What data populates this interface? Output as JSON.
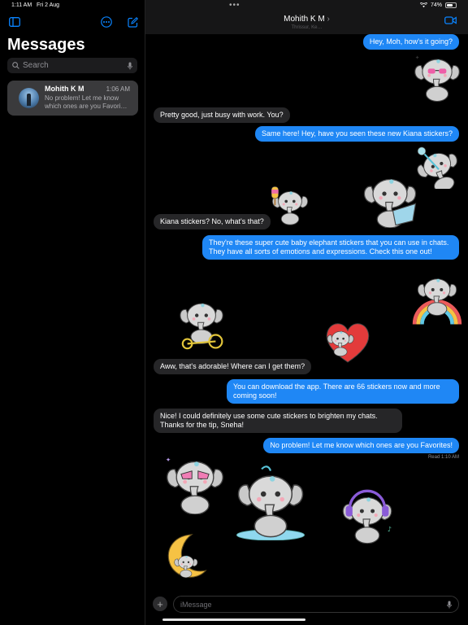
{
  "status_bar": {
    "time": "1:11 AM",
    "date": "Fri 2 Aug",
    "battery": "74%",
    "battery_level": 0.74
  },
  "sidebar": {
    "title": "Messages",
    "search_placeholder": "Search",
    "conversations": [
      {
        "name": "Mohith K M",
        "time": "1:06 AM",
        "preview": "No problem! Let me know which ones are you Favori…"
      }
    ]
  },
  "chat": {
    "contact_name": "Mohith K M",
    "contact_subtitle": "Thrissur, Ke…",
    "messages": [
      {
        "dir": "out",
        "text": "Hey, Moh, how's it going?"
      },
      {
        "dir": "in",
        "text": "Pretty good, just busy with work. You?"
      },
      {
        "dir": "out",
        "text": "Same here! Hey, have you seen these new Kiana stickers?"
      },
      {
        "dir": "in",
        "text": "Kiana stickers? No, what's that?"
      },
      {
        "dir": "out",
        "text": "They're these super cute baby elephant stickers that you can use in chats. They have all sorts of emotions and expressions. Check this one out!"
      },
      {
        "dir": "in",
        "text": "Aww, that's adorable! Where can I get them?"
      },
      {
        "dir": "out",
        "text": "You can download the app. There are 66 stickers now and more coming soon!"
      },
      {
        "dir": "in",
        "text": "Nice! I could definitely use some cute stickers to brighten my chats. Thanks for the tip, Sneha!"
      },
      {
        "dir": "out",
        "text": "No problem! Let me know which ones are you Favorites!"
      }
    ],
    "read_receipt": "Read 1:10 AM",
    "stickers": [
      {
        "name": "sticker-elephant-sunglasses"
      },
      {
        "name": "sticker-elephant-fan"
      },
      {
        "name": "sticker-elephant-laptop"
      },
      {
        "name": "sticker-elephant-icecream"
      },
      {
        "name": "sticker-elephant-rainbow"
      },
      {
        "name": "sticker-elephant-tricycle"
      },
      {
        "name": "sticker-elephant-heart"
      },
      {
        "name": "sticker-elephant-dab"
      },
      {
        "name": "sticker-elephant-fountain"
      },
      {
        "name": "sticker-elephant-headphones"
      },
      {
        "name": "sticker-elephant-moon"
      }
    ],
    "composer_placeholder": "iMessage"
  },
  "colors": {
    "outgoing": "#1f87f5",
    "incoming": "#262628",
    "accent": "#0a84ff",
    "background": "#000000"
  }
}
